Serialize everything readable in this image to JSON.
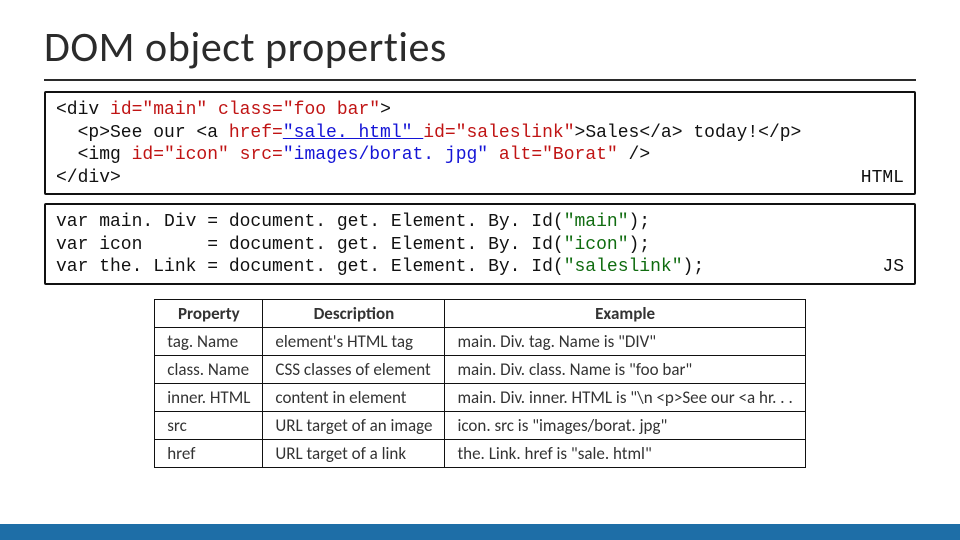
{
  "title": "DOM object properties",
  "html_box": {
    "lang": "HTML",
    "l1_a": "<div ",
    "l1_b": "id=\"main\"",
    "l1_c": " ",
    "l1_d": "class=\"foo bar\"",
    "l1_e": ">",
    "l2_a": "  <p>See our <a ",
    "l2_b": "href=",
    "l2_c": "\"sale. html\" ",
    "l2_d": "id=\"saleslink\"",
    "l2_e": ">Sales</a> today!</p>",
    "l3_a": "  <img ",
    "l3_b": "id=\"icon\"",
    "l3_c": " ",
    "l3_d": "src=",
    "l3_e": "\"images/borat. jpg\" ",
    "l3_f": "alt=\"Borat\"",
    "l3_g": " />",
    "l4": "</div>"
  },
  "js_box": {
    "lang": "JS",
    "l1_a": "var main. Div = document. get. Element. By. Id(",
    "l1_b": "\"main\"",
    "l1_c": ");",
    "l2_a": "var icon      = document. get. Element. By. Id(",
    "l2_b": "\"icon\"",
    "l2_c": ");",
    "l3_a": "var the. Link = document. get. Element. By. Id(",
    "l3_b": "\"saleslink\"",
    "l3_c": ");"
  },
  "table": {
    "headers": {
      "c0": "Property",
      "c1": "Description",
      "c2": "Example"
    },
    "rows": [
      {
        "prop": "tag. Name",
        "desc": "element's HTML tag",
        "ex": "main. Div. tag. Name is \"DIV\""
      },
      {
        "prop": "class. Name",
        "desc": "CSS classes of element",
        "ex": "main. Div. class. Name is \"foo bar\""
      },
      {
        "prop": "inner. HTML",
        "desc": "content in element",
        "ex": "main. Div. inner. HTML is \"\\n <p>See our <a hr. . ."
      },
      {
        "prop": "src",
        "desc": "URL target of an image",
        "ex": "icon. src is \"images/borat. jpg\""
      },
      {
        "prop": "href",
        "desc": "URL target of a link",
        "ex": "the. Link. href is \"sale. html\""
      }
    ]
  }
}
